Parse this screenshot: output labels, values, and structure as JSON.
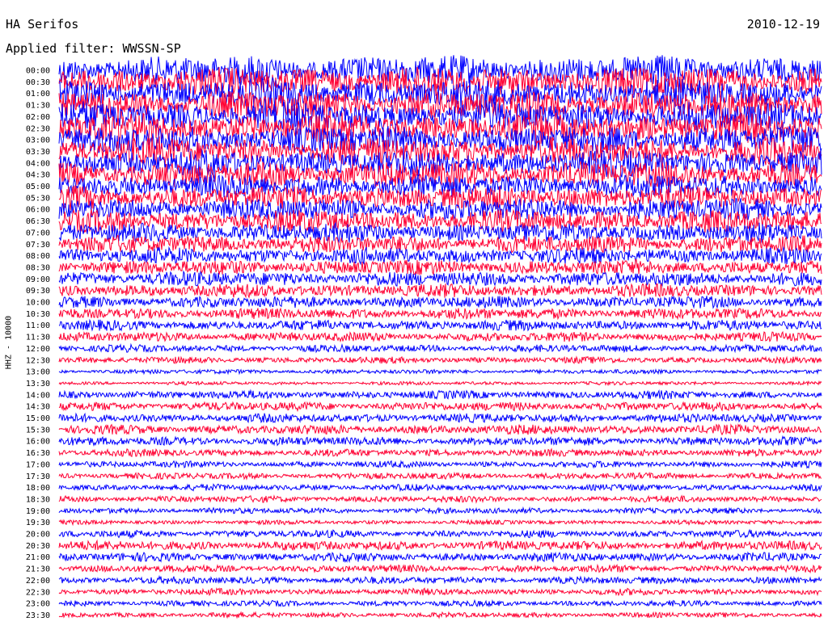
{
  "header": {
    "station": "HA Serifos",
    "date": "2010-12-19",
    "filter_label": "Applied filter: WWSSN-SP",
    "channel_label": "HHZ - 10000"
  },
  "chart_data": {
    "type": "line",
    "title": "HA Serifos",
    "ylabel": "HHZ - 10000",
    "colors": [
      "#0000ff",
      "#ff0033"
    ],
    "rows": [
      {
        "label": "00:00",
        "amplitude": 1.0
      },
      {
        "label": "00:30",
        "amplitude": 1.0
      },
      {
        "label": "01:00",
        "amplitude": 1.0
      },
      {
        "label": "01:30",
        "amplitude": 1.0
      },
      {
        "label": "02:00",
        "amplitude": 1.0
      },
      {
        "label": "02:30",
        "amplitude": 1.0
      },
      {
        "label": "03:00",
        "amplitude": 0.95
      },
      {
        "label": "03:30",
        "amplitude": 0.95
      },
      {
        "label": "04:00",
        "amplitude": 0.9
      },
      {
        "label": "04:30",
        "amplitude": 0.9
      },
      {
        "label": "05:00",
        "amplitude": 0.8
      },
      {
        "label": "05:30",
        "amplitude": 0.8
      },
      {
        "label": "06:00",
        "amplitude": 0.75
      },
      {
        "label": "06:30",
        "amplitude": 0.75
      },
      {
        "label": "07:00",
        "amplitude": 0.65
      },
      {
        "label": "07:30",
        "amplitude": 0.6
      },
      {
        "label": "08:00",
        "amplitude": 0.55
      },
      {
        "label": "08:30",
        "amplitude": 0.5
      },
      {
        "label": "09:00",
        "amplitude": 0.5
      },
      {
        "label": "09:30",
        "amplitude": 0.45
      },
      {
        "label": "10:00",
        "amplitude": 0.4
      },
      {
        "label": "10:30",
        "amplitude": 0.38
      },
      {
        "label": "11:00",
        "amplitude": 0.35
      },
      {
        "label": "11:30",
        "amplitude": 0.32
      },
      {
        "label": "12:00",
        "amplitude": 0.25
      },
      {
        "label": "12:30",
        "amplitude": 0.22
      },
      {
        "label": "13:00",
        "amplitude": 0.15
      },
      {
        "label": "13:30",
        "amplitude": 0.12
      },
      {
        "label": "14:00",
        "amplitude": 0.28
      },
      {
        "label": "14:30",
        "amplitude": 0.3
      },
      {
        "label": "15:00",
        "amplitude": 0.3
      },
      {
        "label": "15:30",
        "amplitude": 0.32
      },
      {
        "label": "16:00",
        "amplitude": 0.3
      },
      {
        "label": "16:30",
        "amplitude": 0.25
      },
      {
        "label": "17:00",
        "amplitude": 0.22
      },
      {
        "label": "17:30",
        "amplitude": 0.22
      },
      {
        "label": "18:00",
        "amplitude": 0.22
      },
      {
        "label": "18:30",
        "amplitude": 0.22
      },
      {
        "label": "19:00",
        "amplitude": 0.2
      },
      {
        "label": "19:30",
        "amplitude": 0.15
      },
      {
        "label": "20:00",
        "amplitude": 0.25
      },
      {
        "label": "20:30",
        "amplitude": 0.32
      },
      {
        "label": "21:00",
        "amplitude": 0.3
      },
      {
        "label": "21:30",
        "amplitude": 0.25
      },
      {
        "label": "22:00",
        "amplitude": 0.25
      },
      {
        "label": "22:30",
        "amplitude": 0.22
      },
      {
        "label": "23:00",
        "amplitude": 0.2
      },
      {
        "label": "23:30",
        "amplitude": 0.18
      }
    ]
  }
}
